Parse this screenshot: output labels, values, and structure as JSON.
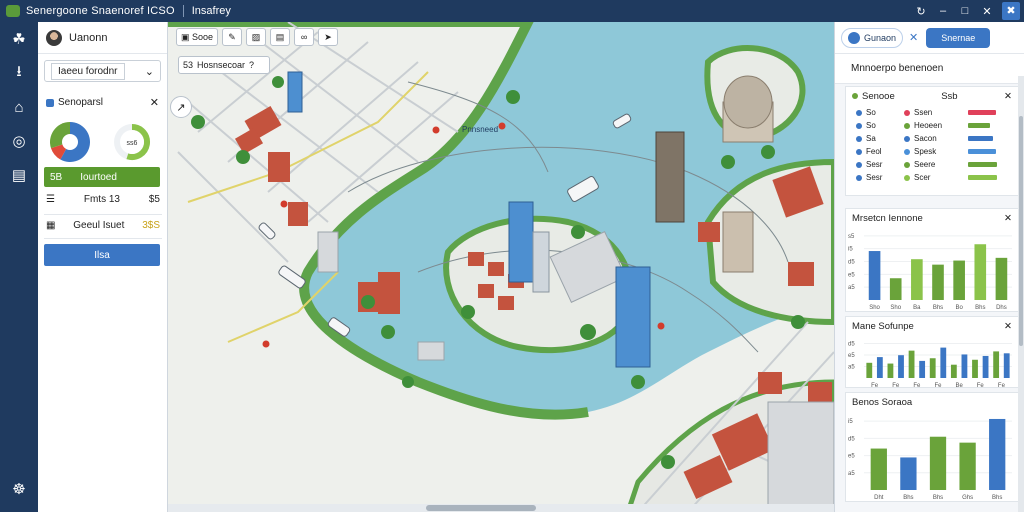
{
  "window": {
    "title": "Senergoone Snaenoref ICSO",
    "subtitle": "Insafrey"
  },
  "rail": {
    "icons": [
      "network-icon",
      "download-icon",
      "home-icon",
      "globe-icon",
      "layers-icon"
    ],
    "bottom_icon": "settings-icon"
  },
  "left_panel": {
    "user_name": "Uanonn",
    "select_value": "Iaeeu forodnr",
    "card_title": "Senoparsl",
    "gauge_value": "ss6",
    "pie_segments": [
      {
        "color": "#3b76c4",
        "value": 58
      },
      {
        "color": "#e04b3a",
        "value": 12
      },
      {
        "color": "#6aa33a",
        "value": 30
      }
    ],
    "gauge_fraction": 0.55,
    "green_button": "Iourtoed",
    "green_button_code": "5B",
    "row1": {
      "label": "Fmts 13",
      "value": "$5"
    },
    "row2": {
      "label": "Geeul Isuet",
      "value": "3$S"
    },
    "blue_button": "Ilsa"
  },
  "map": {
    "toolbar": [
      "Sooe",
      "",
      "",
      "",
      ""
    ],
    "search_text": "Hosnsecoar",
    "search_prefix": "53",
    "search_suffix": "?",
    "place_label": "Pnnsneed",
    "compass": "↗"
  },
  "right_panel": {
    "chip_label": "Gunaon",
    "primary_button": "Snernae",
    "header": "Mnnoerpo benenoen",
    "layers": {
      "title": "Senooe",
      "col2_title": "Ssb",
      "rows": [
        {
          "c1": "So",
          "c2": "Ssen",
          "color": "#e0405a",
          "bar": 0.82
        },
        {
          "c1": "So",
          "c2": "Heoeen",
          "color": "#6aa33a",
          "bar": 0.66
        },
        {
          "c1": "Sa",
          "c2": "Sacon",
          "color": "#3b76c4",
          "bar": 0.74
        },
        {
          "c1": "Feol",
          "c2": "Spesk",
          "color": "#4a90d9",
          "bar": 0.82
        },
        {
          "c1": "Sesr",
          "c2": "Seere",
          "color": "#6aa33a",
          "bar": 0.86
        },
        {
          "c1": "Sesr",
          "c2": "Scer",
          "color": "#8bc34a",
          "bar": 0.84
        }
      ]
    },
    "chart_titles": [
      "Mrsetcn Iennone",
      "Mane Sofunpe",
      "Benos Soraoa"
    ]
  },
  "chart_data": [
    {
      "type": "bar",
      "title": "Mrsetcn Iennone",
      "yticks": [
        "a5",
        "e5",
        "d5",
        "i5",
        "s5"
      ],
      "categories": [
        "Sho",
        "Sho",
        "Ba",
        "Bhs",
        "Bo",
        "Bhs",
        "Dhs"
      ],
      "series": [
        {
          "values": [
            72,
            32,
            60,
            52,
            58,
            82,
            62
          ]
        }
      ],
      "colors": [
        "#3b76c4",
        "#6aa33a",
        "#8bc34a",
        "#6aa33a",
        "#6aa33a",
        "#8bc34a",
        "#6aa33a"
      ],
      "ylim": [
        0,
        100
      ]
    },
    {
      "type": "bar",
      "title": "Mane Sofunpe",
      "yticks": [
        "a5",
        "e5",
        "d5"
      ],
      "categories": [
        "Fe",
        "Fe",
        "Fe",
        "Fe",
        "Be",
        "Fe",
        "Fe"
      ],
      "series": [
        {
          "values": [
            40,
            55,
            38,
            60,
            72,
            45,
            52,
            80,
            35,
            62,
            48,
            58,
            70,
            65
          ]
        }
      ],
      "colors": [
        "#6aa33a",
        "#3b76c4",
        "#6aa33a",
        "#3b76c4",
        "#6aa33a",
        "#3b76c4",
        "#6aa33a",
        "#3b76c4",
        "#6aa33a",
        "#3b76c4",
        "#6aa33a",
        "#3b76c4",
        "#6aa33a",
        "#3b76c4"
      ],
      "ylim": [
        0,
        100
      ]
    },
    {
      "type": "bar",
      "title": "Benos Soraoa",
      "yticks": [
        "a5",
        "e5",
        "d5",
        "i5"
      ],
      "categories": [
        "Dht",
        "Bhs",
        "Bhs",
        "Ghs",
        "Bhs"
      ],
      "series": [
        {
          "values": [
            56,
            44,
            72,
            64,
            96
          ]
        }
      ],
      "colors": [
        "#6aa33a",
        "#3b76c4",
        "#6aa33a",
        "#6aa33a",
        "#3b76c4"
      ],
      "ylim": [
        0,
        100
      ]
    }
  ]
}
